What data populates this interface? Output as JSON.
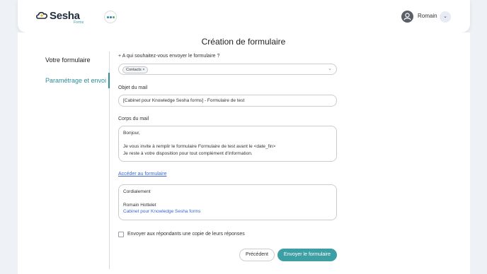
{
  "header": {
    "logo_text": "Sesha",
    "logo_sub": "Forms",
    "user_name": "Romain",
    "colors": {
      "brand_teal": "#3d9fa3",
      "link_blue": "#3c66d6"
    }
  },
  "page": {
    "title": "Création de formulaire"
  },
  "sidebar": {
    "items": [
      {
        "label": "Votre formulaire",
        "active": false
      },
      {
        "label": "Paramétrage et envoi",
        "active": true
      }
    ]
  },
  "form": {
    "recipients_label": "+ A qui souhaitez-vous envoyer le formulaire ?",
    "recipients_chip": "Contacts",
    "subject_label": "Objet du mail",
    "subject_value": "[Cabinet pour Knowledge Sesha forms] - Formulaire de test",
    "body_label": "Corps du mail",
    "body_lines": [
      "Bonjour,",
      "Je vous invite à remplir le formulaire Formulaire de test avant le <date_fin>",
      "Je reste à votre disposition pour tout complément d'information."
    ],
    "form_link": "Accéder au formulaire",
    "signature": {
      "line1": "Cordialement",
      "name": "Romain Hottelet",
      "company": "Cabinet pour Knowledge Sesha forms"
    },
    "copy_checkbox_label": "Envoyer aux répondants une copie de leurs réponses",
    "copy_checkbox_checked": false
  },
  "buttons": {
    "previous": "Précédent",
    "send": "Envoyer le formulaire"
  }
}
